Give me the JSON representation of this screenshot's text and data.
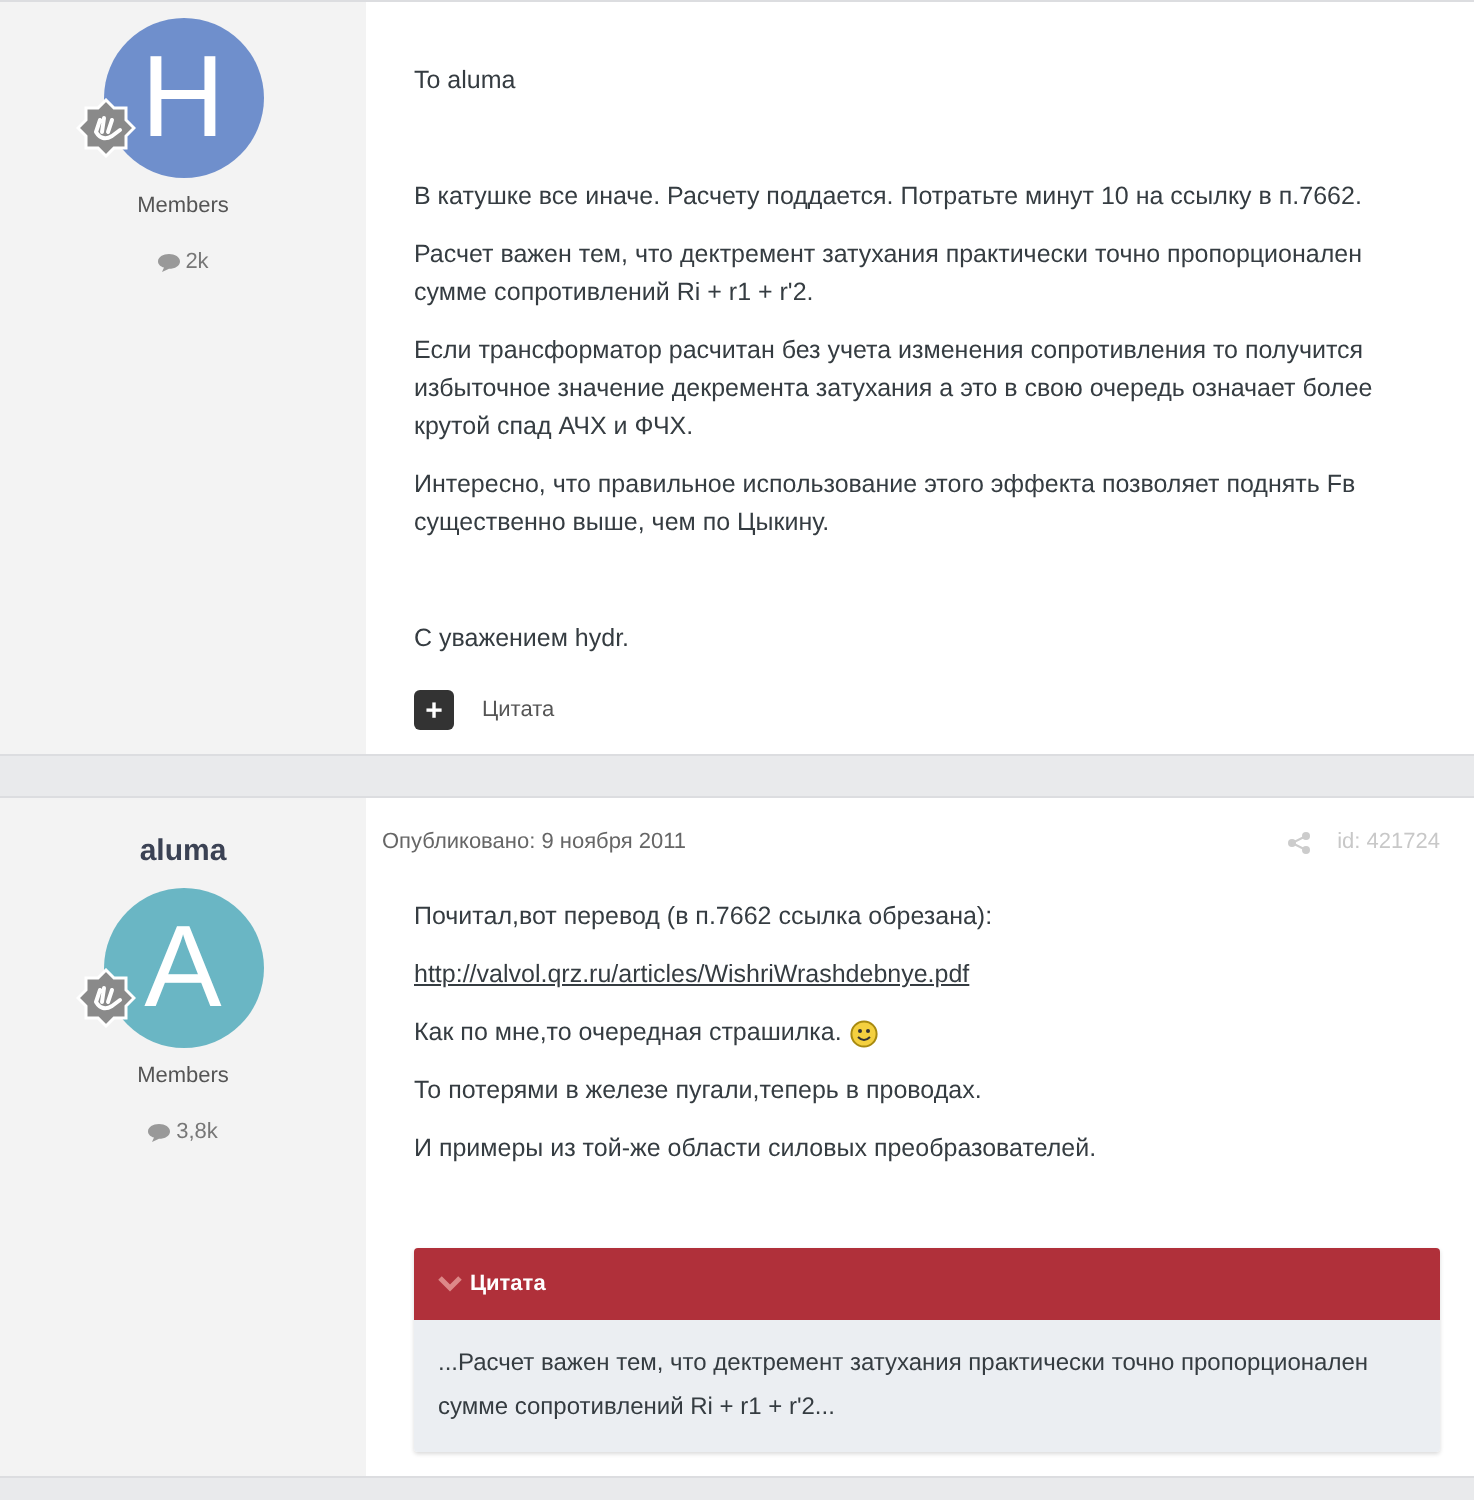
{
  "posts": [
    {
      "author": {
        "initial": "H",
        "color": "#6f8fcc",
        "group": "Members",
        "posts_count": "2k"
      },
      "blocks": [
        [
          {
            "kind": "text",
            "text": "To aluma"
          }
        ],
        [
          {
            "kind": "text",
            "text": "В катушке все иначе. Расчету поддается. Потратьте минут 10 на ссылку в п.7662."
          },
          {
            "kind": "text",
            "text": "Расчет важен тем, что дектремент затухания практически точно пропорционален сумме сопротивлений Ri + r1 + r'2."
          },
          {
            "kind": "text",
            "text": "Если трансформатор расчитан без учета изменения сопротивления то получится избыточное значение декремента затухания а это в свою очередь означает более крутой спад АЧХ и ФЧХ."
          },
          {
            "kind": "text",
            "text": "Интересно, что правильное использование этого эффекта позволяет поднять Fв существенно выше, чем по Цыкину."
          }
        ],
        [
          {
            "kind": "text",
            "text": "С уважением hydr."
          }
        ]
      ],
      "quote_button": {
        "icon": "+",
        "label": "Цитата"
      }
    },
    {
      "author": {
        "name": "aluma",
        "initial": "A",
        "color": "#6ab6c4",
        "group": "Members",
        "posts_count": "3,8k"
      },
      "meta": {
        "published": "Опубликовано: 9 ноября 2011",
        "id": "id: 421724"
      },
      "blocks": [
        [
          {
            "kind": "text",
            "text": "Почитал,вот перевод (в п.7662 ссылка обрезана):"
          },
          {
            "kind": "link",
            "text": "http://valvol.qrz.ru/articles/WishriWrashdebnye.pdf"
          },
          {
            "kind": "smiley",
            "text": "Как по мне,то очередная страшилка."
          },
          {
            "kind": "text",
            "text": "То потерями в железе пугали,теперь в проводах."
          },
          {
            "kind": "text",
            "text": "И примеры из той-же области силовых преобразователей."
          }
        ]
      ],
      "quote": {
        "title": "Цитата",
        "text": "...Расчет важен тем, что дектремент затухания практически точно пропорционален сумме сопротивлений Ri + r1 + r'2..."
      }
    }
  ]
}
